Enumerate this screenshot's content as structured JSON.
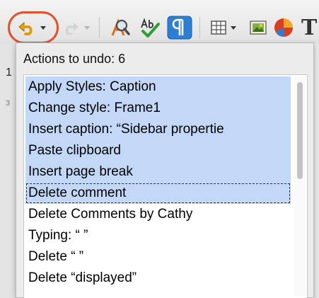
{
  "toolbar": {
    "icons": [
      "undo-icon",
      "redo-icon",
      "find-replace-icon",
      "spellcheck-icon",
      "formatting-marks-icon",
      "table-icon",
      "image-icon",
      "chart-icon",
      "text-icon"
    ],
    "text_tool_glyph": "T"
  },
  "document": {
    "ruler_mark_1": "1",
    "ruler_mark_2": "3"
  },
  "undo_popup": {
    "label": "Actions to undo: 6",
    "items": [
      "Apply Styles: Caption",
      "Change style: Frame1",
      "Insert caption: “Sidebar propertie",
      "Paste clipboard",
      "Insert page break",
      "Delete comment",
      "Delete Comments by Cathy",
      "Typing: “ ”",
      "Delete “ ”",
      "Delete “displayed”"
    ],
    "selected_count": 6
  },
  "colors": {
    "highlight_ring": "#e0522a",
    "selection": "#c3d7f7",
    "undo_arrow": "#e8a317",
    "formatting_marks_bg": "#2d7fd4"
  }
}
